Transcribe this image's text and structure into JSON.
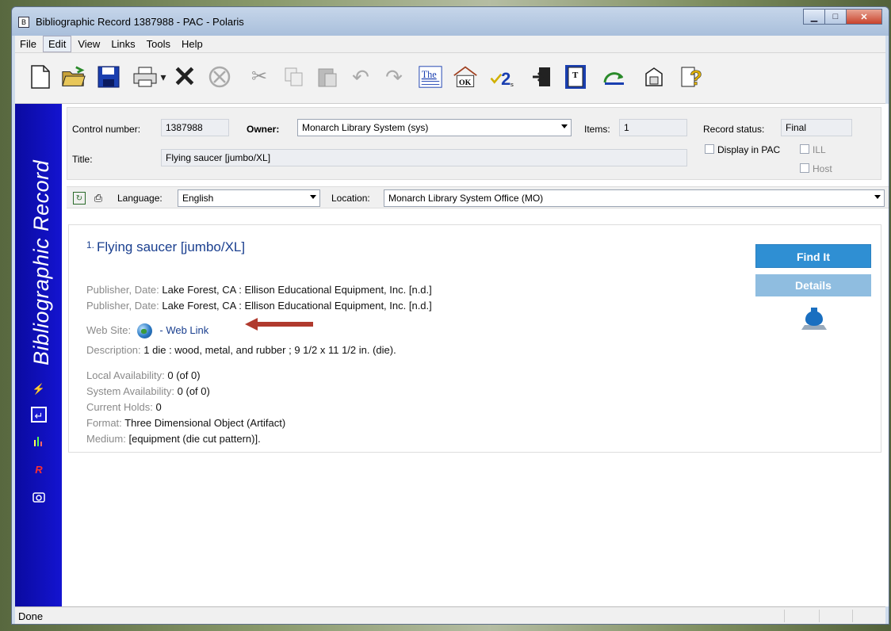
{
  "window": {
    "title": "Bibliographic Record 1387988 - PAC -  Polaris",
    "app_icon": "B",
    "controls": {
      "minimize": "▁",
      "maximize": "□",
      "close": "✕"
    }
  },
  "menu": [
    "File",
    "Edit",
    "View",
    "Links",
    "Tools",
    "Help"
  ],
  "toolbar_icons": [
    "new-document-icon",
    "open-folder-icon",
    "save-icon",
    "print-icon",
    "print-dropdown-icon",
    "delete-icon",
    "cancel-icon",
    "cut-icon",
    "copy-icon",
    "paste-icon",
    "undo-icon",
    "redo-icon",
    "thesaurus-icon",
    "fix-ok-icon",
    "spell-check-icon",
    "export-icon",
    "tag-view-icon",
    "refresh-icon",
    "properties-icon",
    "help-icon"
  ],
  "sidebar": {
    "title": "Bibliographic Record",
    "icons": [
      "spark-icon",
      "record-icon",
      "bar-chart-icon",
      "rz-icon",
      "camera-icon"
    ]
  },
  "header": {
    "control_number_label": "Control number:",
    "control_number": "1387988",
    "owner_label": "Owner:",
    "owner": "Monarch Library System (sys)",
    "items_label": "Items:",
    "items": "1",
    "record_status_label": "Record status:",
    "record_status": "Final",
    "title_label": "Title:",
    "title": "Flying saucer [jumbo/XL]",
    "display_in_pac": "Display in PAC",
    "ill": "ILL",
    "host": "Host"
  },
  "filterbar": {
    "language_label": "Language:",
    "language": "English",
    "location_label": "Location:",
    "location": "Monarch Library System Office (MO)"
  },
  "record": {
    "number": "1.",
    "title": "Flying saucer [jumbo/XL]",
    "publisher_key": "Publisher, Date:",
    "publisher_1": "Lake Forest, CA : Ellison Educational Equipment, Inc. [n.d.]",
    "publisher_2": "Lake Forest, CA : Ellison Educational Equipment, Inc. [n.d.]",
    "website_key": "Web Site:",
    "website_link": "- Web Link",
    "description_key": "Description:",
    "description": "1 die : wood, metal, and rubber ; 9 1/2 x 11 1/2 in. (die).",
    "local_key": "Local Availability:",
    "local": "0 (of 0)",
    "system_key": "System Availability:",
    "system": "0 (of 0)",
    "holds_key": "Current Holds:",
    "holds": "0",
    "format_key": "Format:",
    "format": "Three Dimensional Object (Artifact)",
    "medium_key": "Medium:",
    "medium": "[equipment (die cut pattern)].",
    "find_it": "Find It",
    "details": "Details"
  },
  "status": {
    "text": "Done"
  },
  "colors": {
    "sidebar": "#1414d0",
    "find_button": "#2f8fd3",
    "details_button": "#8fbde0",
    "link": "#1a3f8f",
    "arrow": "#b03a2e"
  }
}
